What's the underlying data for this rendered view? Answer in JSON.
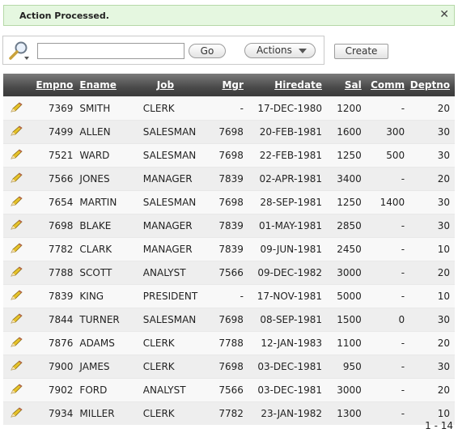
{
  "banner": {
    "message": "Action Processed.",
    "close_glyph": "✕"
  },
  "search": {
    "value": "",
    "go_label": "Go",
    "actions_label": "Actions",
    "search_icon": "magnifier-icon"
  },
  "create_label": "Create",
  "table": {
    "columns": [
      "Empno",
      "Ename",
      "Job",
      "Mgr",
      "Hiredate",
      "Sal",
      "Comm",
      "Deptno"
    ],
    "edit_icon": "pencil-icon",
    "rows": [
      [
        "7369",
        "SMITH",
        "CLERK",
        "-",
        "17-DEC-1980",
        "1200",
        "-",
        "20"
      ],
      [
        "7499",
        "ALLEN",
        "SALESMAN",
        "7698",
        "20-FEB-1981",
        "1600",
        "300",
        "30"
      ],
      [
        "7521",
        "WARD",
        "SALESMAN",
        "7698",
        "22-FEB-1981",
        "1250",
        "500",
        "30"
      ],
      [
        "7566",
        "JONES",
        "MANAGER",
        "7839",
        "02-APR-1981",
        "3400",
        "-",
        "20"
      ],
      [
        "7654",
        "MARTIN",
        "SALESMAN",
        "7698",
        "28-SEP-1981",
        "1250",
        "1400",
        "30"
      ],
      [
        "7698",
        "BLAKE",
        "MANAGER",
        "7839",
        "01-MAY-1981",
        "2850",
        "-",
        "30"
      ],
      [
        "7782",
        "CLARK",
        "MANAGER",
        "7839",
        "09-JUN-1981",
        "2450",
        "-",
        "10"
      ],
      [
        "7788",
        "SCOTT",
        "ANALYST",
        "7566",
        "09-DEC-1982",
        "3000",
        "-",
        "20"
      ],
      [
        "7839",
        "KING",
        "PRESIDENT",
        "-",
        "17-NOV-1981",
        "5000",
        "-",
        "10"
      ],
      [
        "7844",
        "TURNER",
        "SALESMAN",
        "7698",
        "08-SEP-1981",
        "1500",
        "0",
        "30"
      ],
      [
        "7876",
        "ADAMS",
        "CLERK",
        "7788",
        "12-JAN-1983",
        "1100",
        "-",
        "20"
      ],
      [
        "7900",
        "JAMES",
        "CLERK",
        "7698",
        "03-DEC-1981",
        "950",
        "-",
        "30"
      ],
      [
        "7902",
        "FORD",
        "ANALYST",
        "7566",
        "03-DEC-1981",
        "3000",
        "-",
        "20"
      ],
      [
        "7934",
        "MILLER",
        "CLERK",
        "7782",
        "23-JAN-1982",
        "1300",
        "-",
        "10"
      ]
    ]
  },
  "pagination": "1 - 14",
  "colors": {
    "banner_bg": "#e5f7e0",
    "header_dark": "#4a4a4a",
    "row_alt": "#eeeeee"
  }
}
